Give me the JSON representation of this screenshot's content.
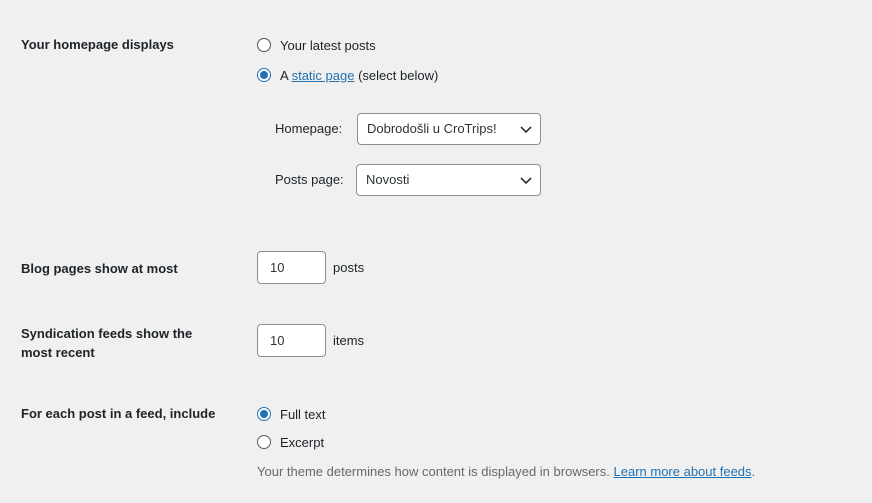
{
  "homepage_displays": {
    "label": "Your homepage displays",
    "options": [
      "Your latest posts"
    ],
    "static_prefix": "A",
    "static_link": "static page",
    "static_suffix": "(select below)",
    "homepage_label": "Homepage:",
    "homepage_value": "Dobrodošli u CroTrips!",
    "posts_label": "Posts page:",
    "posts_value": "Novosti"
  },
  "blog_pages": {
    "label": "Blog pages show at most",
    "value": "10",
    "suffix": "posts"
  },
  "syndication": {
    "label_line1": "Syndication feeds show the",
    "label_line2": "most recent",
    "value": "10",
    "suffix": "items"
  },
  "feed_include": {
    "label": "For each post in a feed, include",
    "option_full": "Full text",
    "option_excerpt": "Excerpt",
    "description": "Your theme determines how content is displayed in browsers.",
    "learn_more": "Learn more about feeds",
    "period": "."
  },
  "colors": {
    "accent": "#2271b1",
    "background": "#f0f0f1",
    "text": "#1d2327"
  }
}
